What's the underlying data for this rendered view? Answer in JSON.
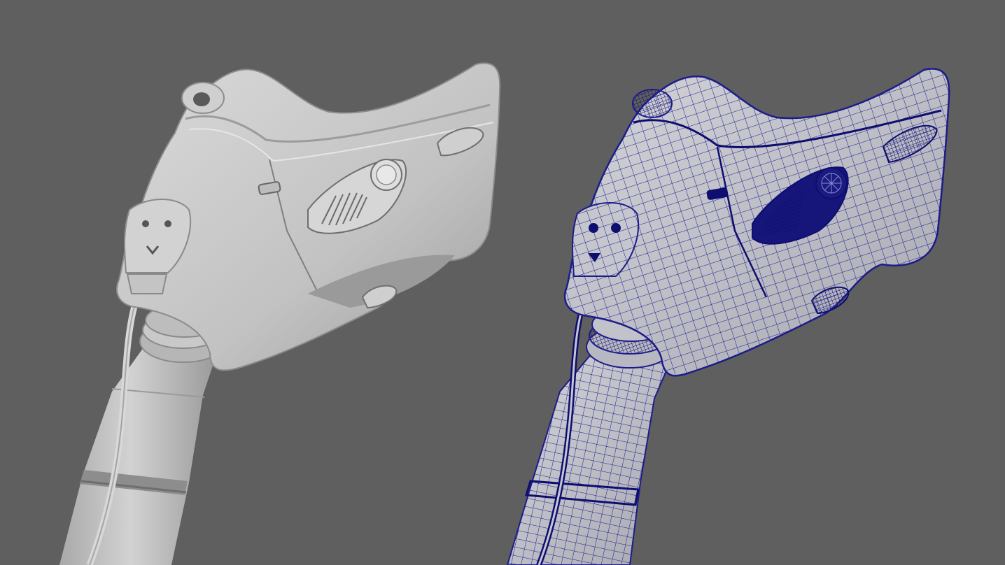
{
  "viewport": {
    "background": "#5f5f5f"
  },
  "models": [
    {
      "name": "oxygen-mask-shaded",
      "shading": "smooth-shaded",
      "surface_color": "#c4c4c4"
    },
    {
      "name": "oxygen-mask-wireframe",
      "shading": "wireframe-on-shaded",
      "surface_color": "#c9c9cc",
      "wire_color": "#1c1c8a"
    }
  ]
}
